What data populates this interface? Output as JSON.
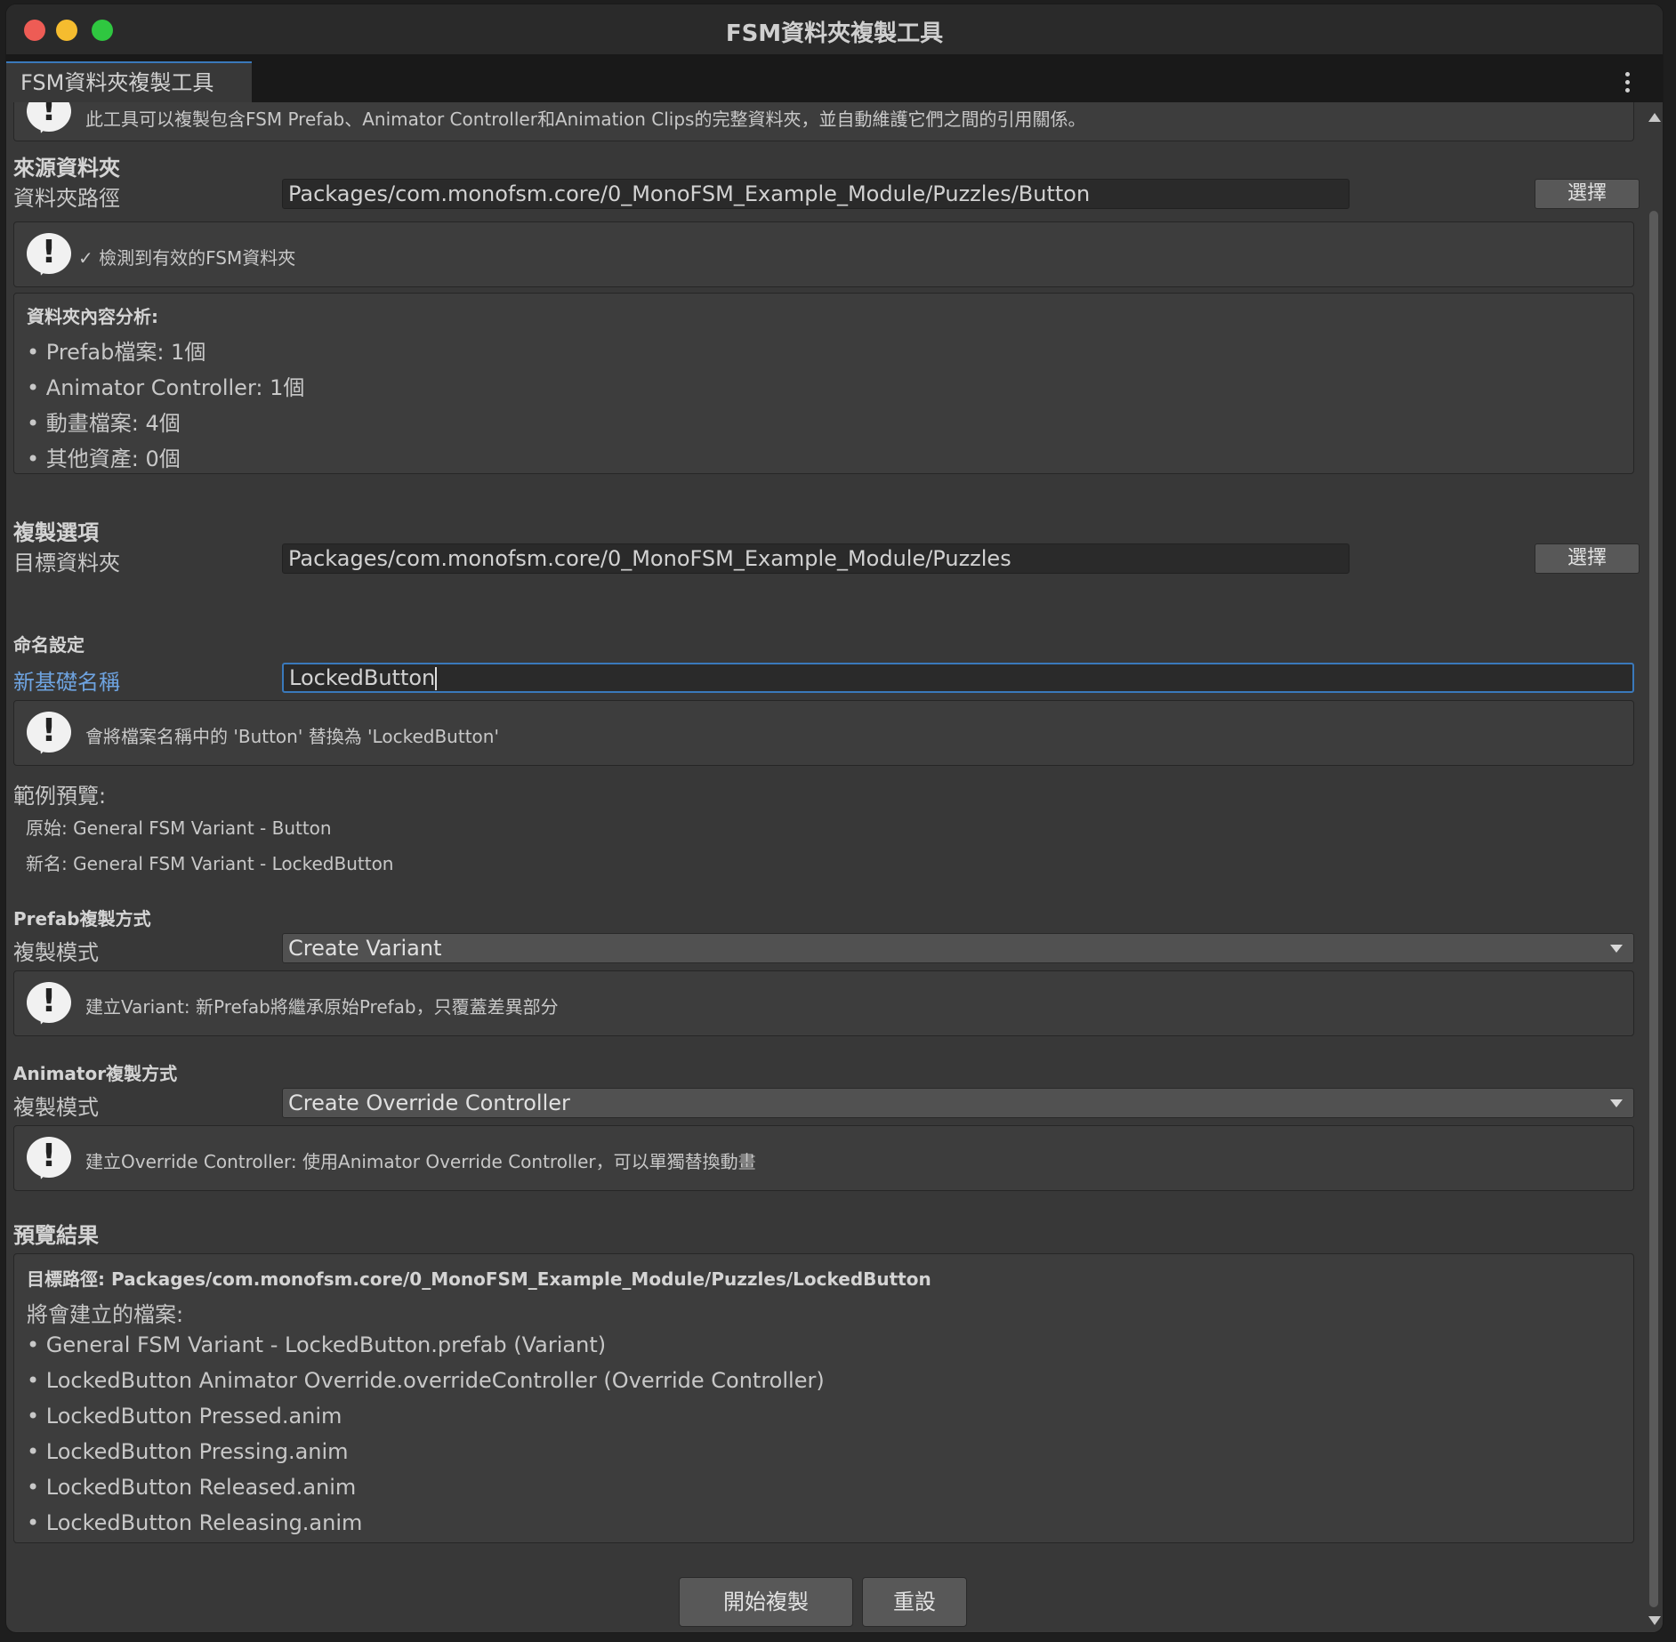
{
  "window": {
    "title": "FSM資料夾複製工具",
    "tab_label": "FSM資料夾複製工具"
  },
  "intro": {
    "text": "此工具可以複製包含FSM Prefab、Animator Controller和Animation Clips的完整資料夾，並自動維護它們之間的引用關係。"
  },
  "source": {
    "section_title": "來源資料夾",
    "path_label": "資料夾路徑",
    "path_value": "Packages/com.monofsm.core/0_MonoFSM_Example_Module/Puzzles/Button",
    "select_button": "選擇",
    "valid_check": "✓",
    "valid_message": "檢測到有效的FSM資料夾"
  },
  "analysis": {
    "title": "資料夾內容分析:",
    "items": [
      "• Prefab檔案: 1個",
      "• Animator Controller: 1個",
      "• 動畫檔案: 4個",
      "• 其他資產: 0個"
    ]
  },
  "copy_options": {
    "section_title": "複製選項",
    "target_label": "目標資料夾",
    "target_value": "Packages/com.monofsm.core/0_MonoFSM_Example_Module/Puzzles",
    "select_button": "選擇"
  },
  "naming": {
    "title": "命名設定",
    "new_name_label": "新基礎名稱",
    "new_name_value": "LockedButton",
    "hint": "會將檔案名稱中的 'Button' 替換為 'LockedButton'",
    "example_title": "範例預覽:",
    "original": "原始: General FSM Variant - Button",
    "renamed": "新名: General FSM Variant - LockedButton"
  },
  "prefab_copy": {
    "title": "Prefab複製方式",
    "mode_label": "複製模式",
    "mode_value": "Create Variant",
    "hint": "建立Variant: 新Prefab將繼承原始Prefab，只覆蓋差異部分"
  },
  "animator_copy": {
    "title": "Animator複製方式",
    "mode_label": "複製模式",
    "mode_value": "Create Override Controller",
    "hint": "建立Override Controller: 使用Animator Override Controller，可以單獨替換動畫"
  },
  "preview": {
    "section_title": "預覽結果",
    "target_path": "目標路徑: Packages/com.monofsm.core/0_MonoFSM_Example_Module/Puzzles/LockedButton",
    "files_title": "將會建立的檔案:",
    "files": [
      "• General FSM Variant - LockedButton.prefab (Variant)",
      "• LockedButton Animator Override.overrideController (Override Controller)",
      "• LockedButton Pressed.anim",
      "• LockedButton Pressing.anim",
      "• LockedButton Released.anim",
      "• LockedButton Releasing.anim"
    ]
  },
  "actions": {
    "start": "開始複製",
    "reset": "重設"
  },
  "colors": {
    "accent": "#3a79bb",
    "panel": "#383838",
    "field": "#2a2a2a"
  },
  "icons": [
    "help-bubble-icon",
    "kebab-menu-icon",
    "dropdown-arrow-icon",
    "scroll-up-icon",
    "scroll-down-icon"
  ]
}
